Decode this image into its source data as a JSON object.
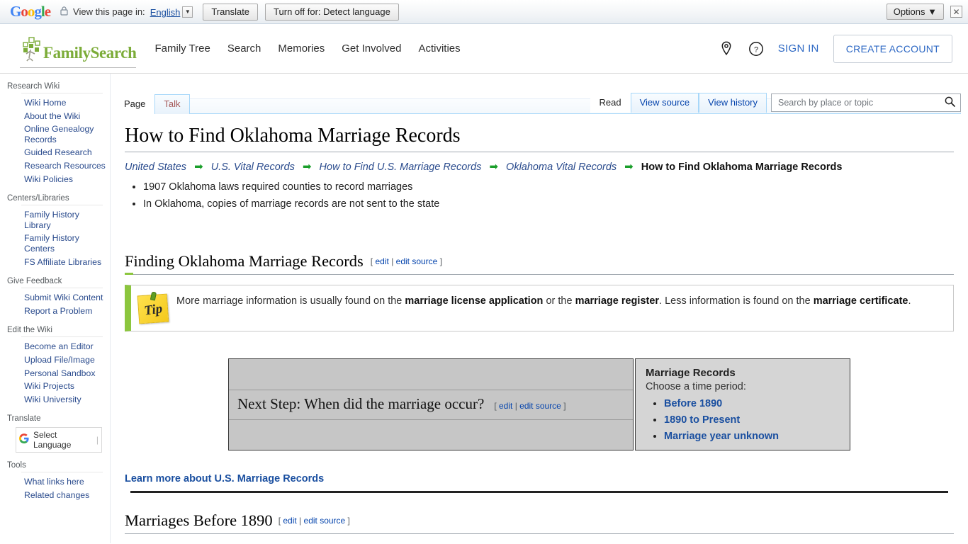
{
  "translate_bar": {
    "logo": "Google",
    "lock_icon": "lock-icon",
    "view_label": "View this page in:",
    "language": "English",
    "translate_button": "Translate",
    "turn_off_button": "Turn off for: Detect language",
    "options_button": "Options",
    "close_icon": "close-icon"
  },
  "header": {
    "brand": "FamilySearch",
    "nav": [
      {
        "label": "Family Tree"
      },
      {
        "label": "Search"
      },
      {
        "label": "Memories"
      },
      {
        "label": "Get Involved"
      },
      {
        "label": "Activities"
      }
    ],
    "location_icon": "location-pin-icon",
    "help_icon": "help-circle-icon",
    "sign_in": "SIGN IN",
    "create_account": "CREATE ACCOUNT"
  },
  "sidebar": {
    "groups": [
      {
        "title": "Research Wiki",
        "items": [
          "Wiki Home",
          "About the Wiki",
          "Online Genealogy Records",
          "Guided Research",
          "Research Resources",
          "Wiki Policies"
        ]
      },
      {
        "title": "Centers/Libraries",
        "items": [
          "Family History Library",
          "Family History Centers",
          "FS Affiliate Libraries"
        ]
      },
      {
        "title": "Give Feedback",
        "items": [
          "Submit Wiki Content",
          "Report a Problem"
        ]
      },
      {
        "title": "Edit the Wiki",
        "items": [
          "Become an Editor",
          "Upload File/Image",
          "Personal Sandbox",
          "Wiki Projects",
          "Wiki University"
        ]
      }
    ],
    "translate": {
      "title": "Translate",
      "widget_label": "Select Language",
      "google_icon": "google-g-icon"
    },
    "tools": {
      "title": "Tools",
      "items": [
        "What links here",
        "Related changes"
      ]
    }
  },
  "tabs": {
    "left": [
      {
        "label": "Page",
        "selected": true
      },
      {
        "label": "Talk",
        "selected": false
      }
    ],
    "right": [
      {
        "label": "Read",
        "selected": true
      },
      {
        "label": "View source",
        "selected": false
      },
      {
        "label": "View history",
        "selected": false
      }
    ]
  },
  "search": {
    "placeholder": "Search by place or topic",
    "value": "",
    "icon": "search-icon"
  },
  "article": {
    "title": "How to Find Oklahoma Marriage Records",
    "breadcrumb": {
      "links": [
        "United States",
        "U.S. Vital Records",
        "How to Find U.S. Marriage Records",
        "Oklahoma Vital Records"
      ],
      "arrow": "➡",
      "current": "How to Find Oklahoma Marriage Records"
    },
    "facts": [
      "1907 Oklahoma laws required counties to record marriages",
      "In Oklahoma, copies of marriage records are not sent to the state"
    ],
    "section_finding": {
      "heading": "Finding Oklahoma Marriage Records",
      "edit": "edit",
      "edit_source": "edit source",
      "bracket_open": "[",
      "bracket_close": "]",
      "separator": "|"
    },
    "tip": {
      "icon": "tip-sticky-note-icon",
      "icon_text": "Tip",
      "text_1": "More marriage information is usually found on the ",
      "bold_1": "marriage license application",
      "text_2": " or the ",
      "bold_2": "marriage register",
      "text_3": ". Less information is found on the ",
      "bold_3": "marriage certificate",
      "text_4": "."
    },
    "next_step": {
      "title": "Next Step: When did the marriage occur?",
      "edit": "edit",
      "edit_source": "edit source"
    },
    "records_box": {
      "heading": "Marriage Records",
      "subheading": "Choose a time period:",
      "options": [
        "Before 1890",
        "1890 to Present",
        "Marriage year unknown"
      ]
    },
    "learn_more": "Learn more about U.S. Marriage Records",
    "section_before_1890": {
      "heading": "Marriages Before 1890",
      "edit": "edit",
      "edit_source": "edit source"
    }
  },
  "colors": {
    "brand_green": "#7cac39",
    "accent_green": "#8cc63e",
    "link_blue": "#2a4b8d",
    "wiki_link": "#0645ad",
    "fs_blue": "#2d68c4"
  }
}
